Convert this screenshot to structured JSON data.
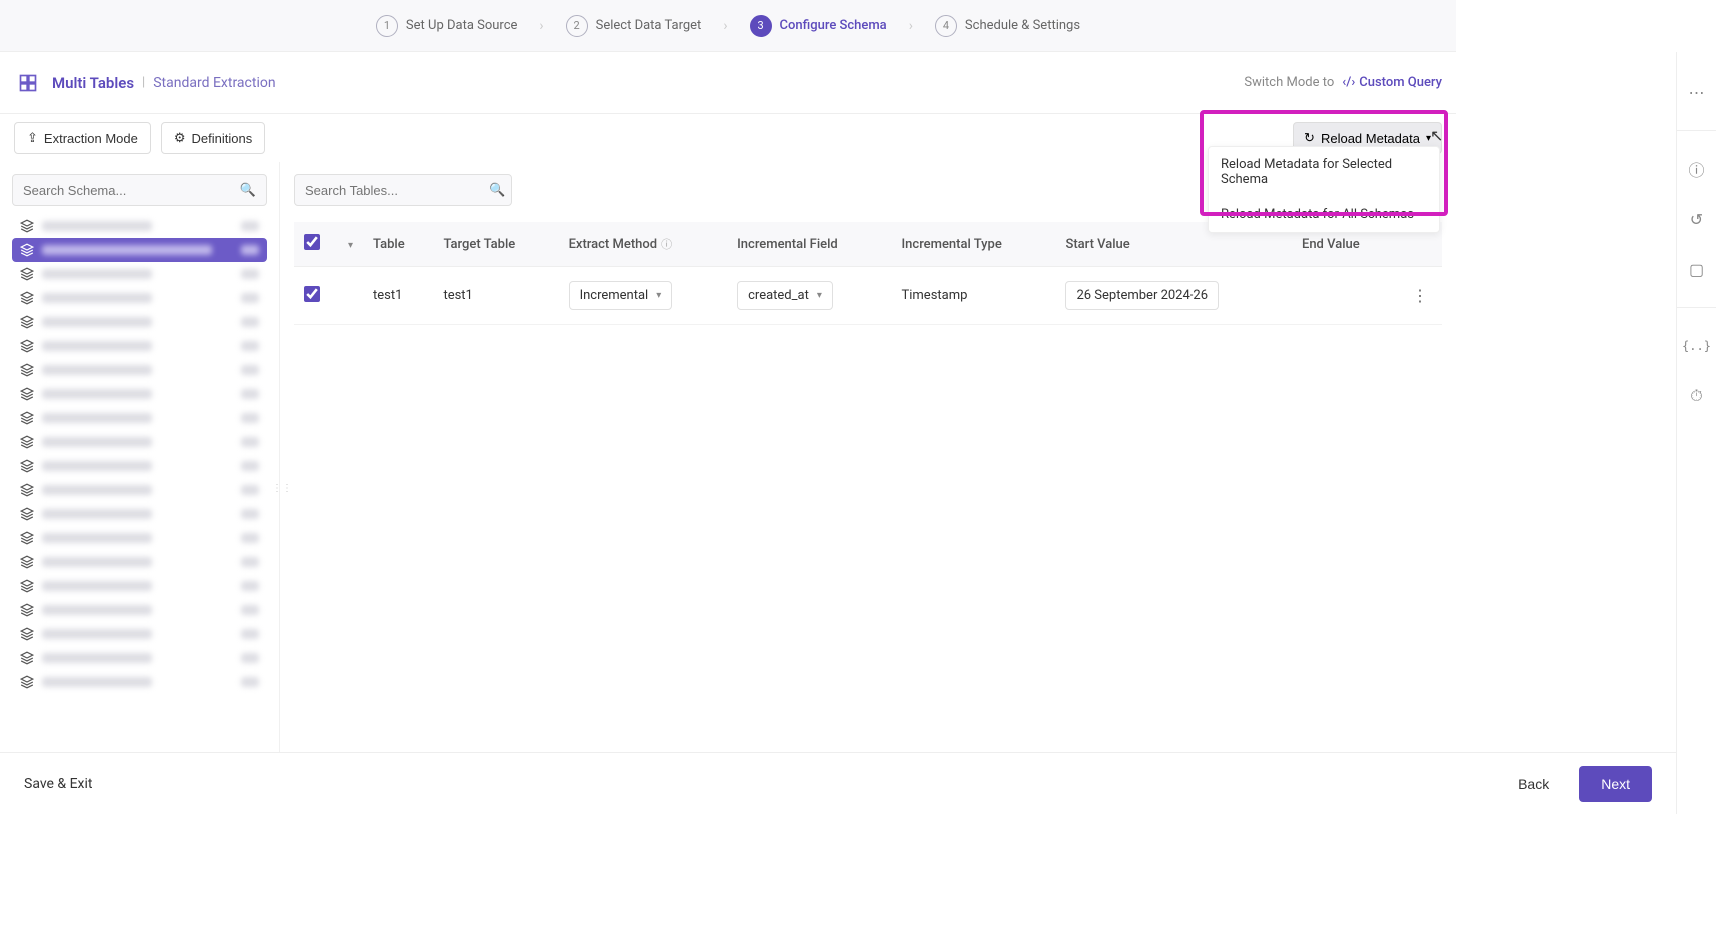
{
  "stepper": {
    "steps": [
      {
        "num": "1",
        "label": "Set Up Data Source"
      },
      {
        "num": "2",
        "label": "Select Data Target"
      },
      {
        "num": "3",
        "label": "Configure Schema"
      },
      {
        "num": "4",
        "label": "Schedule & Settings"
      }
    ],
    "active_index": 2
  },
  "header": {
    "title": "Multi Tables",
    "subtitle": "Standard Extraction",
    "switch_label": "Switch Mode to",
    "custom_query_label": "Custom Query"
  },
  "toolbar": {
    "extraction_mode": "Extraction Mode",
    "definitions": "Definitions",
    "reload_metadata": "Reload Metadata",
    "dropdown": {
      "item1": "Reload Metadata for Selected Schema",
      "item2": "Reload Metadata for All Schemas"
    }
  },
  "search": {
    "schema_placeholder": "Search Schema...",
    "tables_placeholder": "Search Tables..."
  },
  "table": {
    "headers": {
      "table": "Table",
      "target": "Target Table",
      "extract": "Extract Method",
      "inc_field": "Incremental Field",
      "inc_type": "Incremental Type",
      "start": "Start Value",
      "end": "End Value"
    },
    "rows": [
      {
        "table": "test1",
        "target": "test1",
        "extract": "Incremental",
        "inc_field": "created_at",
        "inc_type": "Timestamp",
        "start": "26 September 2024-26",
        "end": ""
      }
    ]
  },
  "footer": {
    "save_exit": "Save & Exit",
    "back": "Back",
    "next": "Next"
  },
  "schema_item_count": 20
}
